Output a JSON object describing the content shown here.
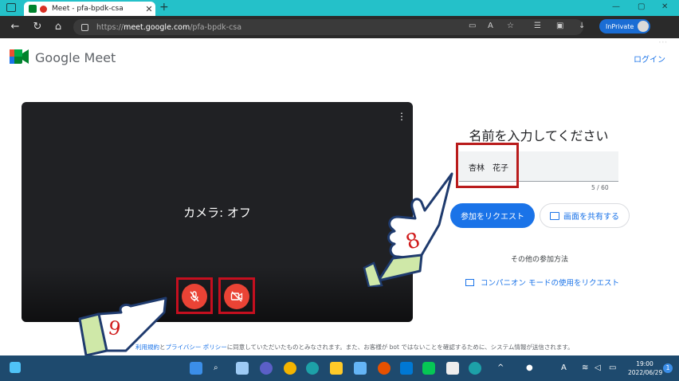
{
  "browser": {
    "tab_title": "Meet - pfa-bpdk-csa",
    "tab_close": "✕",
    "new_tab": "+",
    "url_prefix": "https://",
    "url_host": "meet.google.com",
    "url_path": "/pfa-bpdk-csa",
    "inprivate_label": "InPrivate",
    "minimize": "—",
    "maximize": "▢",
    "close": "✕",
    "more": "···"
  },
  "header": {
    "app_name": "Google Meet",
    "login_link": "ログイン"
  },
  "preview": {
    "camera_status": "カメラ: オフ",
    "menu_glyph": "⋮"
  },
  "join_panel": {
    "heading": "名前を入力してください",
    "name_value": "杏林　花子",
    "name_counter": "5 / 60",
    "join_button": "参加をリクエスト",
    "share_button": "画面を共有する",
    "other_ways": "その他の参加方法",
    "companion_link": "コンパニオン モードの使用をリクエスト"
  },
  "footer": {
    "terms_link": "利用規約",
    "terms_and": "と",
    "privacy_link": "プライバシー ポリシー",
    "terms_text": "に同意していただいたものとみなされます。また、お客様が bot ではないことを確認するために、システム情報が送信されます。"
  },
  "annotations": {
    "hand_right_number": "8",
    "hand_left_number": "9",
    "highlight_color": "#c50f1f"
  },
  "taskbar": {
    "time": "19:00",
    "date": "2022/06/29",
    "notification_count": "1"
  },
  "colors": {
    "accent": "#1a73e8",
    "danger": "#ea4335",
    "tab_strip": "#24c1c9",
    "taskbar": "#1e4a6e"
  }
}
